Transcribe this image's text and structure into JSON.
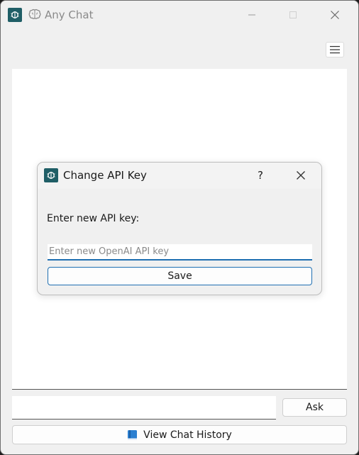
{
  "window": {
    "title": "Any Chat"
  },
  "dialog": {
    "title": "Change API Key",
    "help_label": "?",
    "prompt_label": "Enter new API key:",
    "api_key_value": "",
    "api_key_placeholder": "Enter new OpenAI API key",
    "save_label": "Save"
  },
  "input_row": {
    "question_value": "",
    "ask_label": "Ask"
  },
  "history": {
    "label": "View Chat History",
    "icon": "book-icon"
  },
  "colors": {
    "accent": "#1f6fb2",
    "logo_bg": "#1f5e66",
    "window_bg": "#f0f0f0",
    "chat_bg": "#ffffff"
  }
}
